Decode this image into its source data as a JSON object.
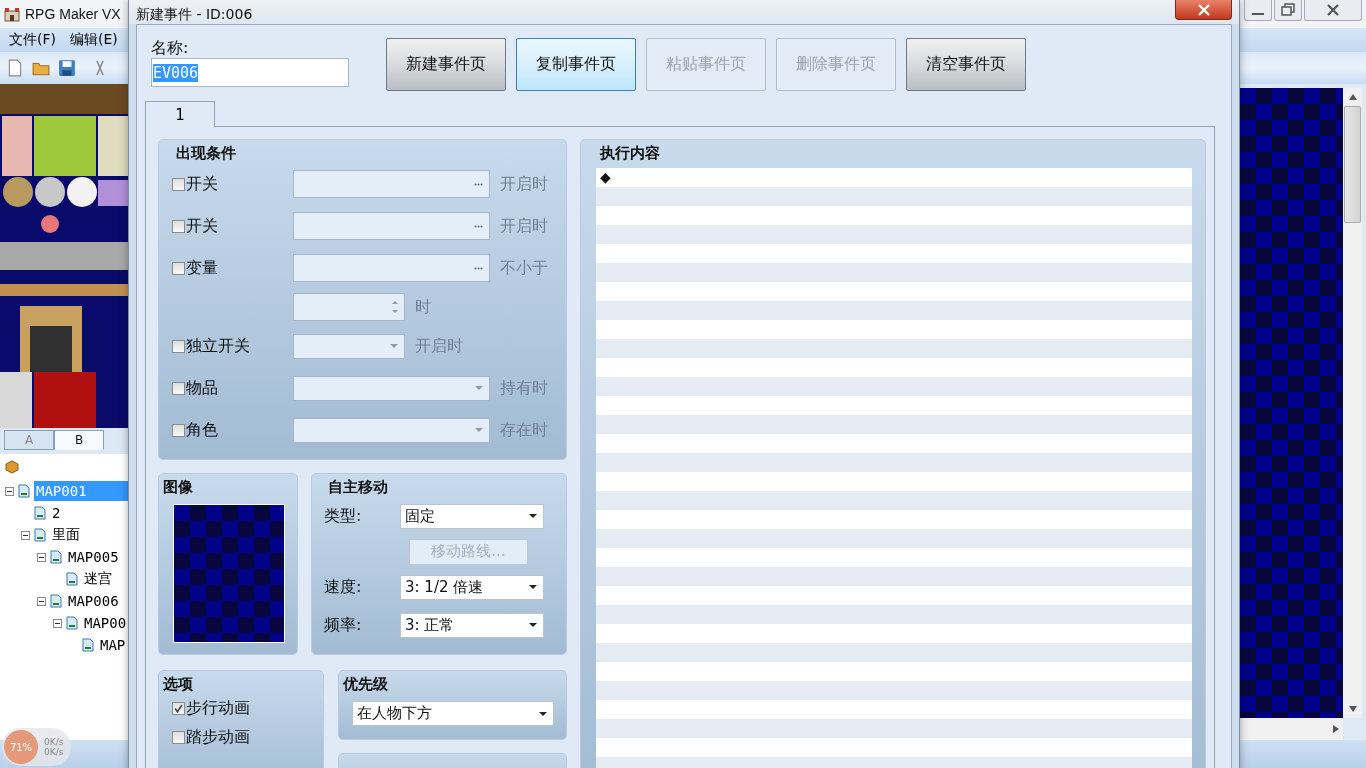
{
  "main_window": {
    "title": "RPG Maker VX",
    "menu": [
      "文件(F)",
      "编辑(E)"
    ],
    "tileset_tabs": [
      {
        "label": "A",
        "selected": false
      },
      {
        "label": "B",
        "selected": true
      }
    ],
    "map_tree": [
      {
        "label": "MAP001",
        "selected": true,
        "expanded": true,
        "children": [
          {
            "label": "2",
            "selected": false
          },
          {
            "label": "里面",
            "selected": false,
            "expanded": true,
            "children": [
              {
                "label": "MAP005",
                "selected": false,
                "expanded": true,
                "children": [
                  {
                    "label": "迷宫",
                    "selected": false
                  }
                ]
              },
              {
                "label": "MAP006",
                "selected": false,
                "expanded": true,
                "children": [
                  {
                    "label": "MAP00",
                    "selected": false,
                    "expanded": true,
                    "children": [
                      {
                        "label": "MAP",
                        "selected": false
                      }
                    ]
                  }
                ]
              }
            ]
          }
        ]
      }
    ],
    "net_meter": {
      "percent": "71%",
      "upload": "0K/s",
      "download": "0K/s"
    }
  },
  "dialog": {
    "title": "新建事件 - ID:006",
    "name_label": "名称:",
    "name_value": "EV006",
    "buttons": [
      {
        "label": "新建事件页",
        "disabled": false,
        "hover": false
      },
      {
        "label": "复制事件页",
        "disabled": false,
        "hover": true
      },
      {
        "label": "粘贴事件页",
        "disabled": true,
        "hover": false
      },
      {
        "label": "删除事件页",
        "disabled": true,
        "hover": false
      },
      {
        "label": "清空事件页",
        "disabled": false,
        "hover": false
      }
    ],
    "page_tabs": [
      {
        "label": "1",
        "selected": true
      }
    ],
    "conditions": {
      "title": "出现条件",
      "rows": [
        {
          "kind": "picker",
          "label": "开关",
          "checked": false,
          "suffix": "开启时"
        },
        {
          "kind": "picker",
          "label": "开关",
          "checked": false,
          "suffix": "开启时"
        },
        {
          "kind": "picker",
          "label": "变量",
          "checked": false,
          "suffix": "不小于"
        },
        {
          "kind": "spin",
          "suffix": "时"
        },
        {
          "kind": "self_switch",
          "label": "独立开关",
          "checked": false,
          "suffix": "开启时"
        },
        {
          "kind": "select",
          "label": "物品",
          "checked": false,
          "suffix": "持有时"
        },
        {
          "kind": "select",
          "label": "角色",
          "checked": false,
          "suffix": "存在时"
        }
      ]
    },
    "image": {
      "title": "图像"
    },
    "movement": {
      "title": "自主移动",
      "rows": [
        {
          "kind": "select",
          "label": "类型:",
          "value": "固定"
        },
        {
          "kind": "button",
          "label": "移动路线...",
          "disabled": true
        },
        {
          "kind": "select",
          "label": "速度:",
          "value": "3: 1/2 倍速"
        },
        {
          "kind": "select",
          "label": "频率:",
          "value": "3: 正常"
        }
      ]
    },
    "options": {
      "title": "选项",
      "items": [
        {
          "label": "步行动画",
          "checked": true
        },
        {
          "label": "踏步动画",
          "checked": false
        }
      ]
    },
    "priority": {
      "title": "优先级",
      "value": "在人物下方"
    },
    "commands": {
      "title": "执行内容",
      "lines": [
        "◆"
      ]
    }
  }
}
